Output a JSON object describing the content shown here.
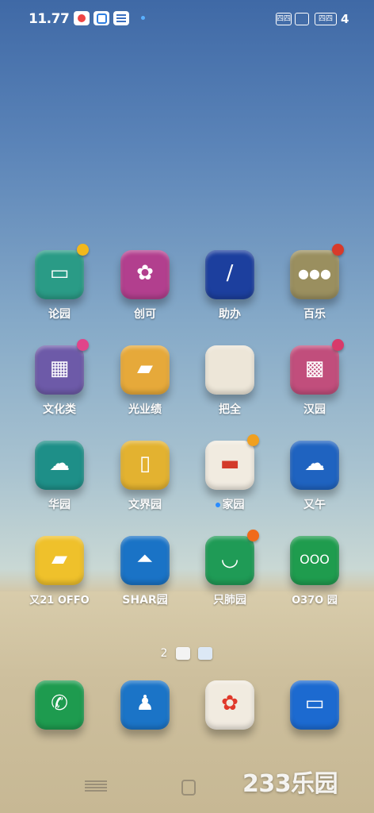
{
  "status_bar": {
    "time": "11.77",
    "signal_label": "四四",
    "battery_label": "四四",
    "battery_suffix": "4"
  },
  "apps": [
    {
      "label": "论园",
      "color": "#2a9b86",
      "badge": "#f2b81d",
      "icon": "notebook-icon",
      "glyph": "▭"
    },
    {
      "label": "创可",
      "color": "#b23f8e",
      "badge": "",
      "icon": "flower-icon",
      "glyph": "✿"
    },
    {
      "label": "助办",
      "color": "#1c3f9e",
      "badge": "",
      "icon": "pen-icon",
      "glyph": "/"
    },
    {
      "label": "百乐",
      "color": "#9a8f5f",
      "badge": "#d83a2a",
      "icon": "dots-icon",
      "glyph": "●●●"
    },
    {
      "label": "文化类",
      "color": "#6d5aa8",
      "badge": "#e0458a",
      "icon": "grid-icon",
      "glyph": "▦"
    },
    {
      "label": "光业绩",
      "color": "#e6a93a",
      "badge": "",
      "icon": "ticket-icon",
      "glyph": "▰"
    },
    {
      "label": "把全",
      "color": "#ede6d8",
      "badge": "",
      "icon": "blank-card-icon",
      "glyph": ""
    },
    {
      "label": "汉园",
      "color": "#c14e7c",
      "badge": "#d83a6a",
      "icon": "pattern-icon",
      "glyph": "▩"
    },
    {
      "label": "华园",
      "color": "#1e8f88",
      "badge": "",
      "icon": "cloud-icon",
      "glyph": "☁"
    },
    {
      "label": "文界园",
      "color": "#e3b230",
      "badge": "",
      "icon": "paper-icon",
      "glyph": "▯"
    },
    {
      "label": "家园",
      "color": "#f1ebe0",
      "badge": "#f0a020",
      "icon": "flag-icon",
      "glyph": "▬",
      "prefix_dot": true
    },
    {
      "label": "又午",
      "color": "#1f63c0",
      "badge": "",
      "icon": "cloud-icon",
      "glyph": "☁"
    },
    {
      "label": "又21 OFFO",
      "color": "#efc12b",
      "badge": "",
      "icon": "cloth-icon",
      "glyph": "▰"
    },
    {
      "label": "SHAR园",
      "color": "#1a73c6",
      "badge": "",
      "icon": "lamp-icon",
      "glyph": "⏶"
    },
    {
      "label": "只肺园",
      "color": "#1f9b56",
      "badge": "#f06a1a",
      "icon": "smile-icon",
      "glyph": "◡"
    },
    {
      "label": "O37O 园",
      "color": "#1f9c4e",
      "badge": "",
      "icon": "ooo-icon",
      "glyph": "OOO"
    }
  ],
  "pager": {
    "number": "2"
  },
  "dock": [
    {
      "color": "#1e9b4f",
      "icon": "phone-icon",
      "glyph": "✆"
    },
    {
      "color": "#1b74c7",
      "icon": "contacts-icon",
      "glyph": "♟"
    },
    {
      "color": "#f1ebe0",
      "icon": "flower-icon",
      "glyph": "✿"
    },
    {
      "color": "#1c6ad0",
      "icon": "gallery-icon",
      "glyph": "▭"
    }
  ],
  "watermark": "233乐园"
}
